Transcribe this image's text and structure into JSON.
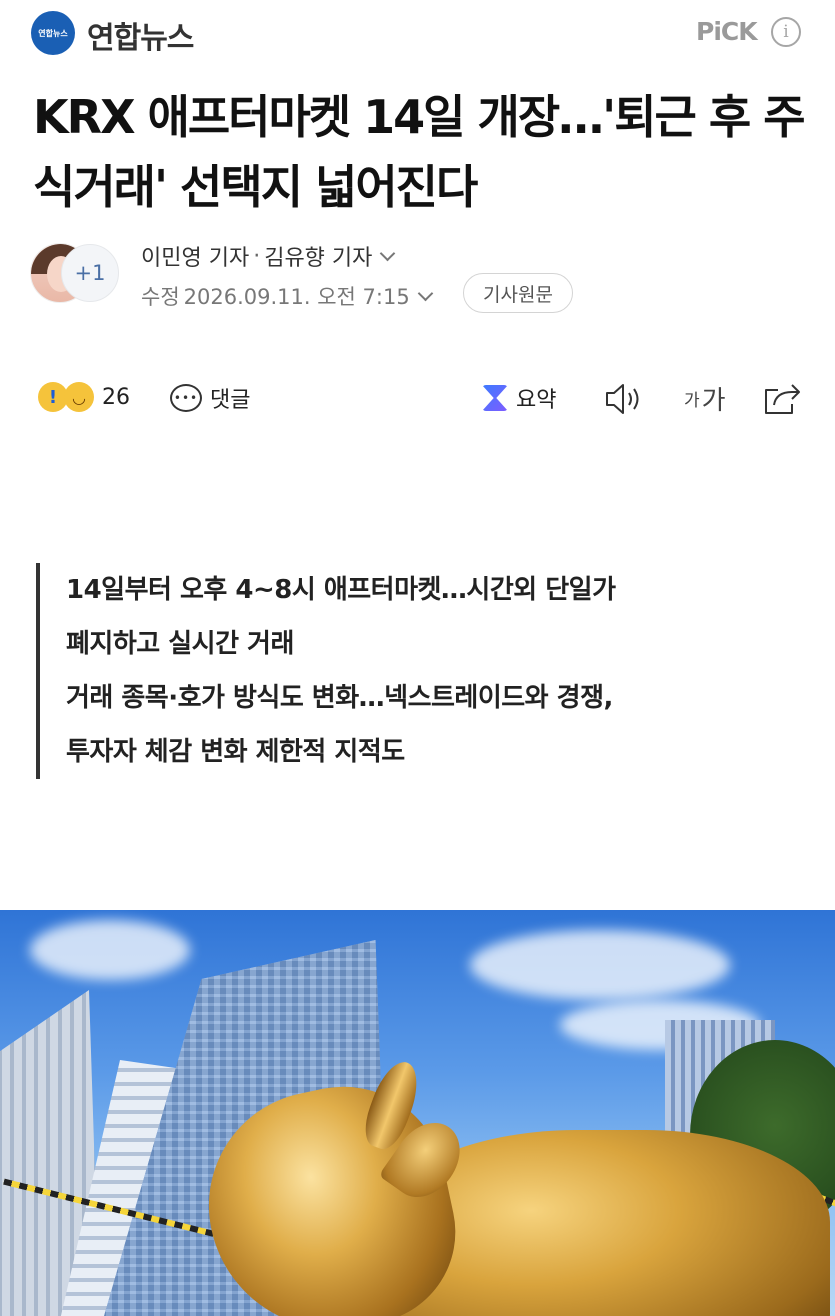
{
  "topbar": {
    "press_logo_text": "연합뉴스",
    "press_name": "연합뉴스",
    "pick_label": "PiCK",
    "info_icon": "i"
  },
  "article": {
    "headline": "KRX 애프터마켓 14일 개장…'퇴근 후 주식거래' 선택지 넓어진다",
    "authors": [
      "이민영 기자",
      "김유향 기자"
    ],
    "author_separator": "·",
    "extra_authors_badge": "+1",
    "date_label": "수정",
    "date_value": "2026.09.11. 오전 7:15",
    "original_button": "기사원문"
  },
  "actions": {
    "reaction_count": "26",
    "comment_label": "댓글",
    "summary_label": "요약",
    "font_small": "가",
    "font_large": "가"
  },
  "summary": {
    "lines": [
      "14일부터 오후 4~8시 애프터마켓…시간외 단일가",
      "폐지하고 실시간 거래",
      "거래 종목·호가 방식도 변화…넥스트레이드와 경쟁,",
      "투자자 체감 변화 제한적 지적도"
    ]
  },
  "colors": {
    "brand_blue": "#1a5fb4",
    "pick_gray": "#9a9a9a",
    "text_dark": "#111111"
  }
}
